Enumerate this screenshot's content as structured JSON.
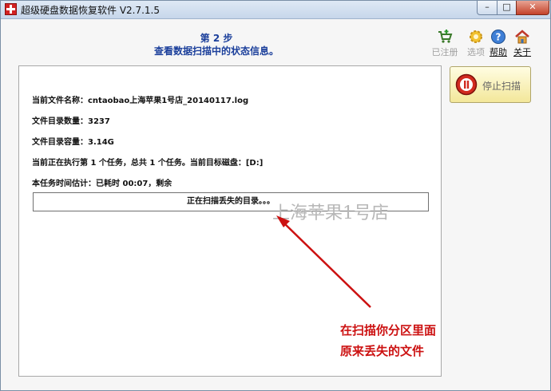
{
  "window": {
    "title": "超级硬盘数据恢复软件 V2.7.1.5",
    "controls": {
      "minimize": "–",
      "maximize": "□",
      "close": "✕"
    }
  },
  "header": {
    "step_title": "第 2 步",
    "step_desc": "查看数据扫描中的状态信息。"
  },
  "toolbar": {
    "register": "已注册",
    "options": "选项",
    "help": "帮助",
    "about": "关于"
  },
  "panel": {
    "file_name_label": "当前文件名称：",
    "file_name_value": "cntaobao上海苹果1号店_20140117.log",
    "dir_count_label": "文件目录数量：",
    "dir_count_value": "3237",
    "dir_size_label": "文件目录容量：",
    "dir_size_value": "3.14G",
    "task_line": "当前正在执行第 1 个任务，总共 1 个任务。当前目标磁盘：[D:]",
    "time_line": "本任务时间估计：已耗时 00:07，剩余",
    "status_text": "正在扫描丢失的目录。。。"
  },
  "actions": {
    "stop_scan": "停止扫描"
  },
  "overlay": {
    "watermark": "上海苹果1号店",
    "annotation_line1": "在扫描你分区里面",
    "annotation_line2": "原来丢失的文件"
  },
  "colors": {
    "step_text": "#1b3f9b",
    "annotation": "#cc1111",
    "stop_button": "#f3e79a"
  }
}
